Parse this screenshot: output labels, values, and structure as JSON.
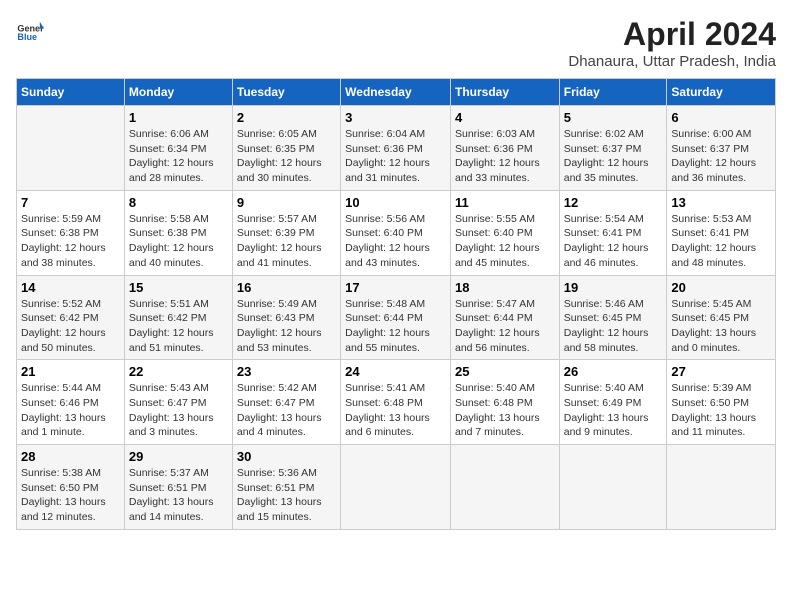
{
  "header": {
    "logo_general": "General",
    "logo_blue": "Blue",
    "title": "April 2024",
    "subtitle": "Dhanaura, Uttar Pradesh, India"
  },
  "days_of_week": [
    "Sunday",
    "Monday",
    "Tuesday",
    "Wednesday",
    "Thursday",
    "Friday",
    "Saturday"
  ],
  "weeks": [
    [
      {
        "day": "",
        "sunrise": "",
        "sunset": "",
        "daylight": ""
      },
      {
        "day": "1",
        "sunrise": "Sunrise: 6:06 AM",
        "sunset": "Sunset: 6:34 PM",
        "daylight": "Daylight: 12 hours and 28 minutes."
      },
      {
        "day": "2",
        "sunrise": "Sunrise: 6:05 AM",
        "sunset": "Sunset: 6:35 PM",
        "daylight": "Daylight: 12 hours and 30 minutes."
      },
      {
        "day": "3",
        "sunrise": "Sunrise: 6:04 AM",
        "sunset": "Sunset: 6:36 PM",
        "daylight": "Daylight: 12 hours and 31 minutes."
      },
      {
        "day": "4",
        "sunrise": "Sunrise: 6:03 AM",
        "sunset": "Sunset: 6:36 PM",
        "daylight": "Daylight: 12 hours and 33 minutes."
      },
      {
        "day": "5",
        "sunrise": "Sunrise: 6:02 AM",
        "sunset": "Sunset: 6:37 PM",
        "daylight": "Daylight: 12 hours and 35 minutes."
      },
      {
        "day": "6",
        "sunrise": "Sunrise: 6:00 AM",
        "sunset": "Sunset: 6:37 PM",
        "daylight": "Daylight: 12 hours and 36 minutes."
      }
    ],
    [
      {
        "day": "7",
        "sunrise": "Sunrise: 5:59 AM",
        "sunset": "Sunset: 6:38 PM",
        "daylight": "Daylight: 12 hours and 38 minutes."
      },
      {
        "day": "8",
        "sunrise": "Sunrise: 5:58 AM",
        "sunset": "Sunset: 6:38 PM",
        "daylight": "Daylight: 12 hours and 40 minutes."
      },
      {
        "day": "9",
        "sunrise": "Sunrise: 5:57 AM",
        "sunset": "Sunset: 6:39 PM",
        "daylight": "Daylight: 12 hours and 41 minutes."
      },
      {
        "day": "10",
        "sunrise": "Sunrise: 5:56 AM",
        "sunset": "Sunset: 6:40 PM",
        "daylight": "Daylight: 12 hours and 43 minutes."
      },
      {
        "day": "11",
        "sunrise": "Sunrise: 5:55 AM",
        "sunset": "Sunset: 6:40 PM",
        "daylight": "Daylight: 12 hours and 45 minutes."
      },
      {
        "day": "12",
        "sunrise": "Sunrise: 5:54 AM",
        "sunset": "Sunset: 6:41 PM",
        "daylight": "Daylight: 12 hours and 46 minutes."
      },
      {
        "day": "13",
        "sunrise": "Sunrise: 5:53 AM",
        "sunset": "Sunset: 6:41 PM",
        "daylight": "Daylight: 12 hours and 48 minutes."
      }
    ],
    [
      {
        "day": "14",
        "sunrise": "Sunrise: 5:52 AM",
        "sunset": "Sunset: 6:42 PM",
        "daylight": "Daylight: 12 hours and 50 minutes."
      },
      {
        "day": "15",
        "sunrise": "Sunrise: 5:51 AM",
        "sunset": "Sunset: 6:42 PM",
        "daylight": "Daylight: 12 hours and 51 minutes."
      },
      {
        "day": "16",
        "sunrise": "Sunrise: 5:49 AM",
        "sunset": "Sunset: 6:43 PM",
        "daylight": "Daylight: 12 hours and 53 minutes."
      },
      {
        "day": "17",
        "sunrise": "Sunrise: 5:48 AM",
        "sunset": "Sunset: 6:44 PM",
        "daylight": "Daylight: 12 hours and 55 minutes."
      },
      {
        "day": "18",
        "sunrise": "Sunrise: 5:47 AM",
        "sunset": "Sunset: 6:44 PM",
        "daylight": "Daylight: 12 hours and 56 minutes."
      },
      {
        "day": "19",
        "sunrise": "Sunrise: 5:46 AM",
        "sunset": "Sunset: 6:45 PM",
        "daylight": "Daylight: 12 hours and 58 minutes."
      },
      {
        "day": "20",
        "sunrise": "Sunrise: 5:45 AM",
        "sunset": "Sunset: 6:45 PM",
        "daylight": "Daylight: 13 hours and 0 minutes."
      }
    ],
    [
      {
        "day": "21",
        "sunrise": "Sunrise: 5:44 AM",
        "sunset": "Sunset: 6:46 PM",
        "daylight": "Daylight: 13 hours and 1 minute."
      },
      {
        "day": "22",
        "sunrise": "Sunrise: 5:43 AM",
        "sunset": "Sunset: 6:47 PM",
        "daylight": "Daylight: 13 hours and 3 minutes."
      },
      {
        "day": "23",
        "sunrise": "Sunrise: 5:42 AM",
        "sunset": "Sunset: 6:47 PM",
        "daylight": "Daylight: 13 hours and 4 minutes."
      },
      {
        "day": "24",
        "sunrise": "Sunrise: 5:41 AM",
        "sunset": "Sunset: 6:48 PM",
        "daylight": "Daylight: 13 hours and 6 minutes."
      },
      {
        "day": "25",
        "sunrise": "Sunrise: 5:40 AM",
        "sunset": "Sunset: 6:48 PM",
        "daylight": "Daylight: 13 hours and 7 minutes."
      },
      {
        "day": "26",
        "sunrise": "Sunrise: 5:40 AM",
        "sunset": "Sunset: 6:49 PM",
        "daylight": "Daylight: 13 hours and 9 minutes."
      },
      {
        "day": "27",
        "sunrise": "Sunrise: 5:39 AM",
        "sunset": "Sunset: 6:50 PM",
        "daylight": "Daylight: 13 hours and 11 minutes."
      }
    ],
    [
      {
        "day": "28",
        "sunrise": "Sunrise: 5:38 AM",
        "sunset": "Sunset: 6:50 PM",
        "daylight": "Daylight: 13 hours and 12 minutes."
      },
      {
        "day": "29",
        "sunrise": "Sunrise: 5:37 AM",
        "sunset": "Sunset: 6:51 PM",
        "daylight": "Daylight: 13 hours and 14 minutes."
      },
      {
        "day": "30",
        "sunrise": "Sunrise: 5:36 AM",
        "sunset": "Sunset: 6:51 PM",
        "daylight": "Daylight: 13 hours and 15 minutes."
      },
      {
        "day": "",
        "sunrise": "",
        "sunset": "",
        "daylight": ""
      },
      {
        "day": "",
        "sunrise": "",
        "sunset": "",
        "daylight": ""
      },
      {
        "day": "",
        "sunrise": "",
        "sunset": "",
        "daylight": ""
      },
      {
        "day": "",
        "sunrise": "",
        "sunset": "",
        "daylight": ""
      }
    ]
  ]
}
